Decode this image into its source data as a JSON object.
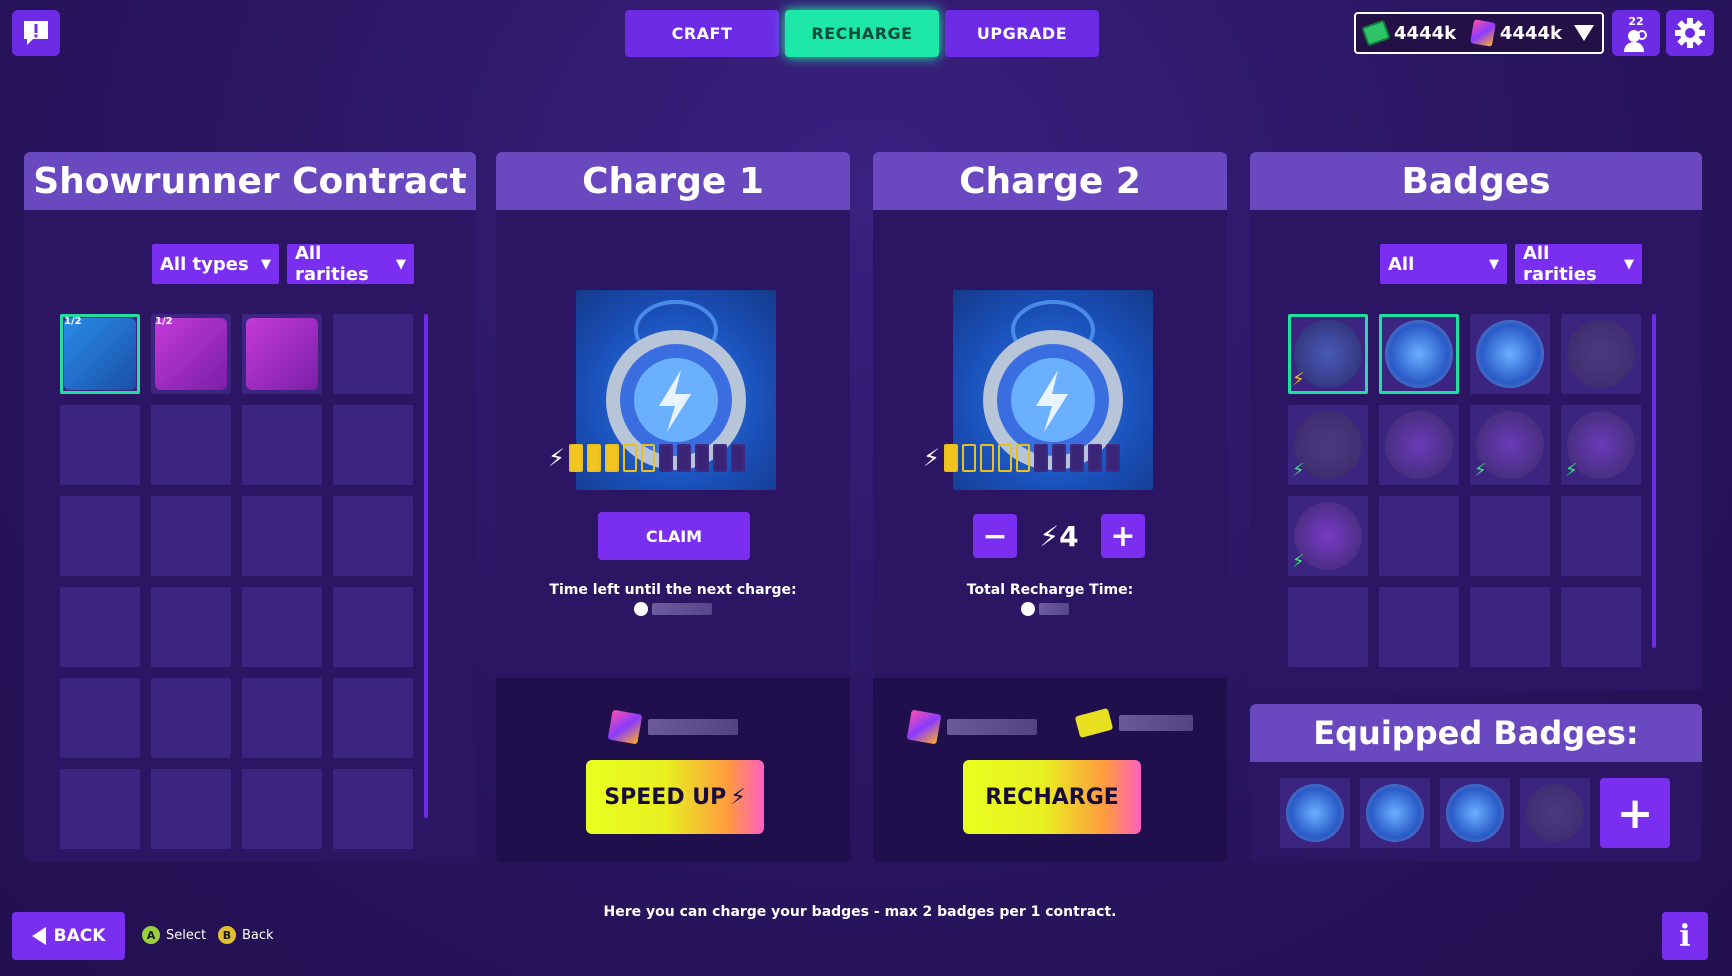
{
  "top_tabs": [
    {
      "label": "CRAFT",
      "active": false
    },
    {
      "label": "RECHARGE",
      "active": true
    },
    {
      "label": "UPGRADE",
      "active": false
    }
  ],
  "currency": {
    "cash": "4444k",
    "cubes": "4444k"
  },
  "friends_count": "22",
  "contract_panel": {
    "title": "Showrunner Contract",
    "filter_type": "All types",
    "filter_rarity": "All rarities",
    "item_label": "1/2"
  },
  "charge1": {
    "title": "Charge 1",
    "claim_label": "CLAIM",
    "timer_label": "Time left until the next charge:",
    "speed_up_label": "SPEED UP"
  },
  "charge2": {
    "title": "Charge 2",
    "amount": "4",
    "total_label": "Total Recharge Time:",
    "recharge_label": "RECHARGE"
  },
  "badges_panel": {
    "title": "Badges",
    "filter_type": "All",
    "filter_rarity": "All rarities"
  },
  "equipped_panel": {
    "title": "Equipped Badges:"
  },
  "bottom": {
    "back_label": "BACK",
    "select_hint": "Select",
    "back_hint": "Back",
    "a_key": "A",
    "b_key": "B",
    "info_text": "Here you can charge your badges - max 2 badges per 1 contract."
  },
  "colors": {
    "accent": "#7a2ff0",
    "active_tab": "#1ee8a8",
    "energy": "#f2c420",
    "background": "#2a1560"
  }
}
